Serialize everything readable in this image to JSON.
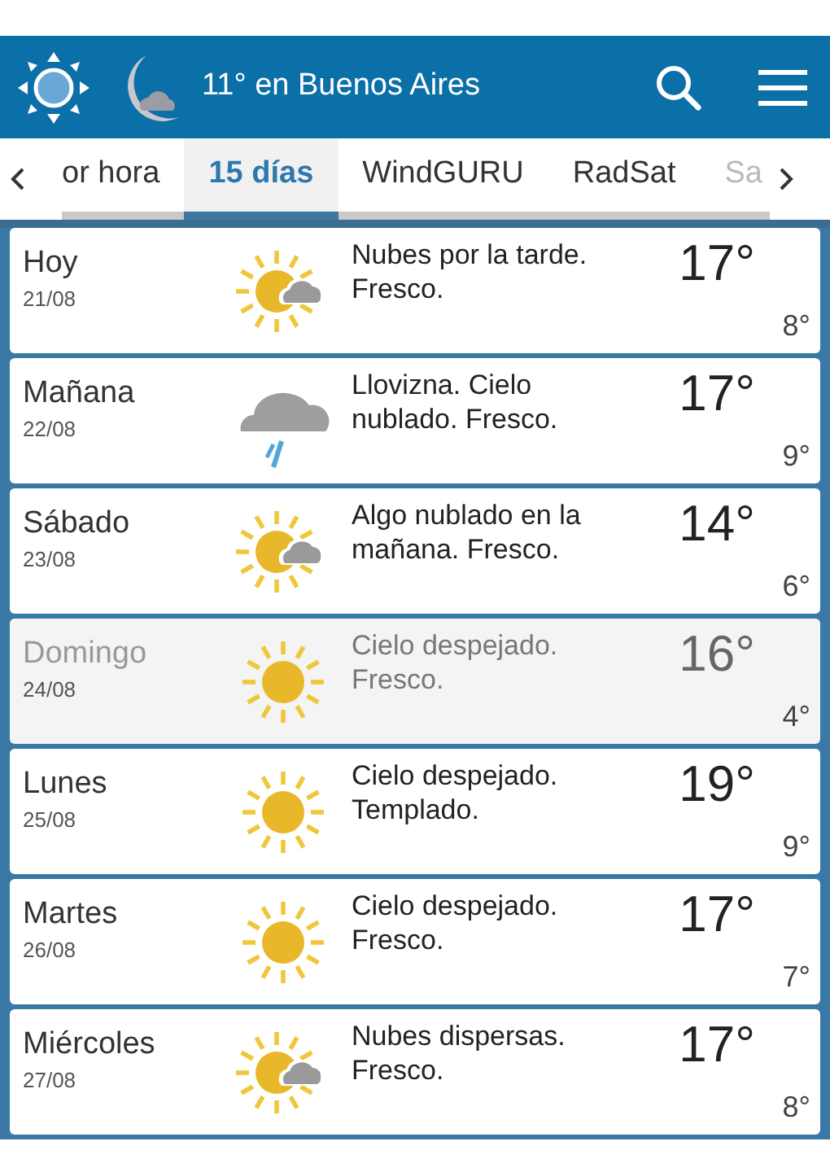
{
  "header": {
    "title": "11° en Buenos Aires"
  },
  "tabs": [
    {
      "label": "or hora",
      "selected": false
    },
    {
      "label": "15 días",
      "selected": true
    },
    {
      "label": "WindGURU",
      "selected": false
    },
    {
      "label": "RadSat",
      "selected": false
    },
    {
      "label": "Sa",
      "selected": false
    }
  ],
  "days": [
    {
      "day": "Hoy",
      "date": "21/08",
      "kind": "sun_cloud",
      "summary": "Nubes por la tarde. Fresco.",
      "high": "17°",
      "low": "8°",
      "dimmed": false
    },
    {
      "day": "Mañana",
      "date": "22/08",
      "kind": "rain",
      "summary": "Llovizna. Cielo nublado. Fresco.",
      "high": "17°",
      "low": "9°",
      "dimmed": false
    },
    {
      "day": "Sábado",
      "date": "23/08",
      "kind": "sun_cloud",
      "summary": "Algo nublado en la mañana. Fresco.",
      "high": "14°",
      "low": "6°",
      "dimmed": false
    },
    {
      "day": "Domingo",
      "date": "24/08",
      "kind": "sun",
      "summary": "Cielo despejado. Fresco.",
      "high": "16°",
      "low": "4°",
      "dimmed": true
    },
    {
      "day": "Lunes",
      "date": "25/08",
      "kind": "sun",
      "summary": "Cielo despejado. Templado.",
      "high": "19°",
      "low": "9°",
      "dimmed": false
    },
    {
      "day": "Martes",
      "date": "26/08",
      "kind": "sun",
      "summary": "Cielo despejado. Fresco.",
      "high": "17°",
      "low": "7°",
      "dimmed": false
    },
    {
      "day": "Miércoles",
      "date": "27/08",
      "kind": "sun_cloud",
      "summary": "Nubes dispersas. Fresco.",
      "high": "17°",
      "low": "8°",
      "dimmed": false
    }
  ]
}
